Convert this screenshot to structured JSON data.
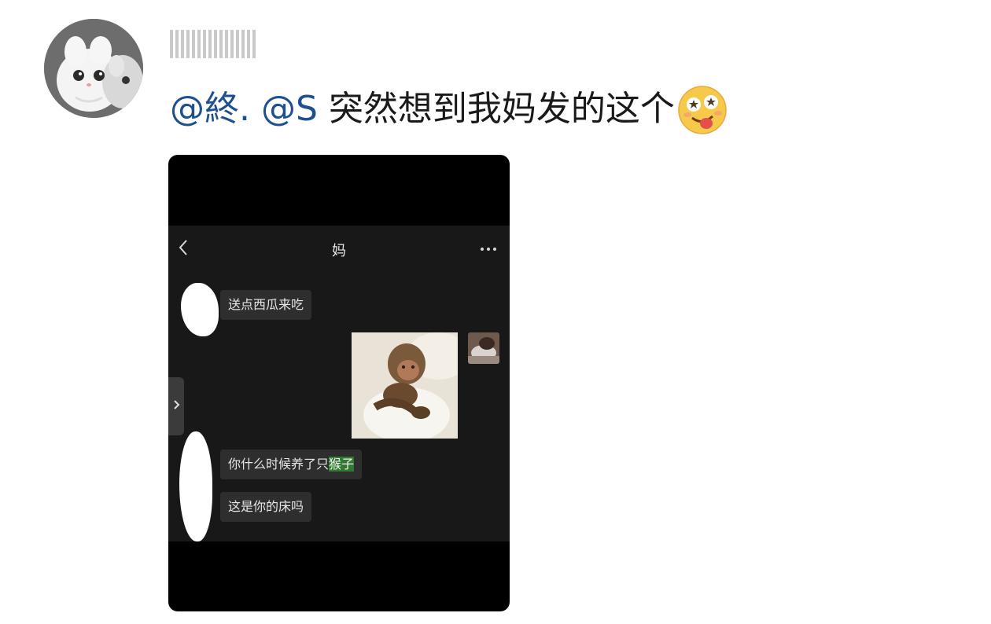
{
  "post": {
    "mentions": [
      "@終.",
      "@S"
    ],
    "body": "突然想到我妈发的这个",
    "emoji_icon": "drooling-face-emoji"
  },
  "chat": {
    "title": "妈",
    "back_icon": "chevron-left-icon",
    "more_icon": "more-dots-icon",
    "side_tab_icon": "chevron-right-icon",
    "messages": [
      {
        "text": "送点西瓜来吃"
      },
      {
        "text_before": "你什么时候养了只",
        "highlight": "猴子"
      },
      {
        "text": "这是你的床吗"
      }
    ],
    "highlight_color": "#2f7a2e"
  },
  "colors": {
    "mention": "#1d4f91",
    "text": "#1a1a1a",
    "chat_bg": "#181818",
    "bubble_bg": "#2e2e2e"
  }
}
